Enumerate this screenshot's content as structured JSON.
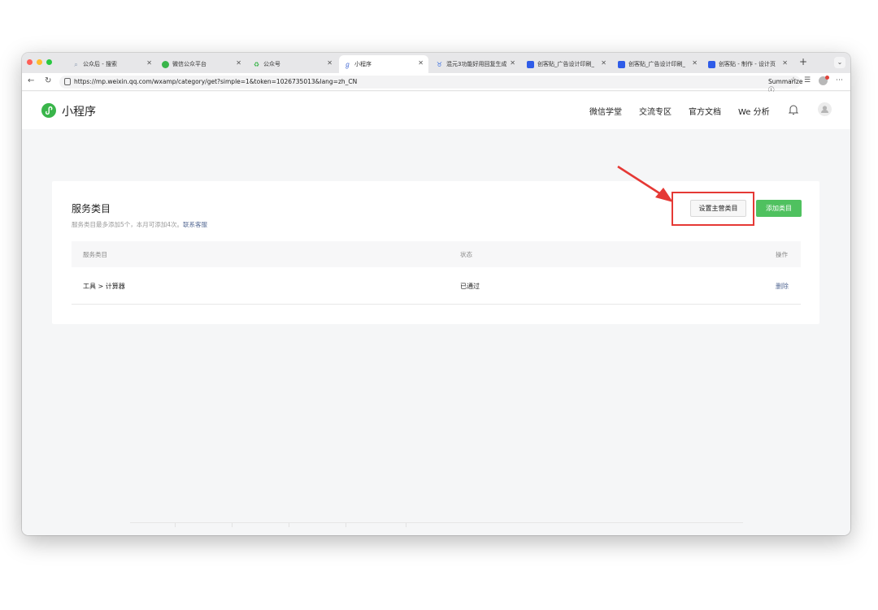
{
  "browser": {
    "tabs": [
      {
        "label": "公众后 - 搜索",
        "icon": "search-icon",
        "icon_color": "#8a9bb0"
      },
      {
        "label": "微信公众平台",
        "icon": "wechat-icon",
        "icon_color": "#39b54a"
      },
      {
        "label": "公众号",
        "icon": "recycle-icon",
        "icon_color": "#39b54a"
      },
      {
        "label": "小程序",
        "icon": "miniprogram-icon",
        "icon_color": "#4a6fd6"
      },
      {
        "label": "混元3功能好用回复生成",
        "icon": "hunyuan-icon",
        "icon_color": "#3b6fe0"
      },
      {
        "label": "创客贴_广告设计印刷_",
        "icon": "chuangketie-icon",
        "icon_color": "#2f5ce8"
      },
      {
        "label": "创客贴_广告设计印刷_",
        "icon": "chuangketie-icon",
        "icon_color": "#2f5ce8"
      },
      {
        "label": "创客贴 - 制作 - 设计页",
        "icon": "chuangketie-icon",
        "icon_color": "#2f5ce8"
      }
    ],
    "active_tab": 3,
    "url": "https://mp.weixin.qq.com/wxamp/category/get?simple=1&token=1026735013&lang=zh_CN",
    "summarize_label": "Summarize"
  },
  "header": {
    "brand": "小程序",
    "brand_color": "#39b54a",
    "nav": [
      "微信学堂",
      "交流专区",
      "官方文档",
      "We 分析"
    ]
  },
  "card": {
    "title": "服务类目",
    "subtitle_prefix": "服务类目最多添加5个，本月可添加4次。",
    "subtitle_link": "联系客服",
    "set_main_button": "设置主营类目",
    "add_button": "添加类目",
    "accent_color": "#4fc15f",
    "highlight_color": "#e53935"
  },
  "table": {
    "headers": [
      "服务类目",
      "状态",
      "操作"
    ],
    "rows": [
      {
        "category": "工具 > 计算器",
        "status": "已通过",
        "action": "删除"
      }
    ]
  }
}
